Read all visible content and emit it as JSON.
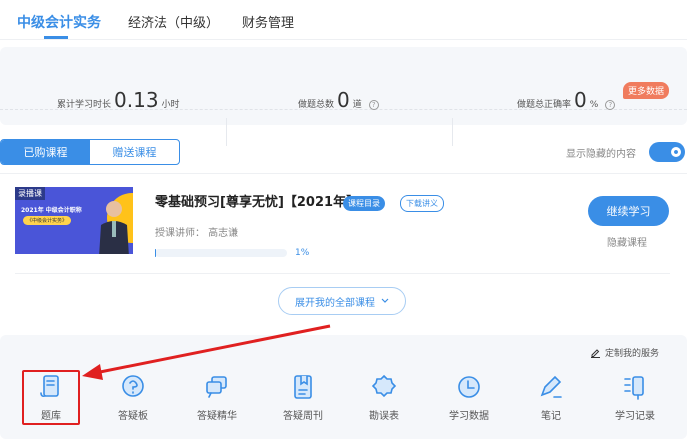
{
  "subject_tabs": [
    {
      "label": "中级会计实务",
      "active": true
    },
    {
      "label": "经济法（中级）"
    },
    {
      "label": "财务管理"
    }
  ],
  "stats": {
    "study_time_label": "累计学习时长",
    "study_time_value": "0.13",
    "study_time_unit": "小时",
    "questions_label": "做题总数",
    "questions_value": "0",
    "questions_unit": "道",
    "accuracy_label": "做题总正确率",
    "accuracy_value": "0",
    "accuracy_unit": "%",
    "help_icon": "?",
    "more_data": "更多数据"
  },
  "course_tabs": [
    {
      "label": "已购课程",
      "active": true
    },
    {
      "label": "赠送课程"
    }
  ],
  "show_hidden_label": "显示隐藏的内容",
  "show_hidden_on": true,
  "course": {
    "thumb_tag": "录播课",
    "thumb_title": "2021年 中级会计职称",
    "thumb_subtitle": "《中级会计实务》",
    "title": "零基础预习[尊享无忧]【2021年】",
    "catalog_label": "课程目录",
    "handout_label": "下载讲义",
    "teacher": "授课讲师： 高志谦",
    "progress_percent": 1,
    "progress_label": "1%",
    "continue_label": "继续学习",
    "hide_label": "隐藏课程"
  },
  "expand_label": "展开我的全部课程",
  "services": {
    "customize_label": "定制我的服务",
    "items": [
      {
        "label": "题库"
      },
      {
        "label": "答疑板"
      },
      {
        "label": "答疑精华"
      },
      {
        "label": "答疑周刊"
      },
      {
        "label": "勘误表"
      },
      {
        "label": "学习数据"
      },
      {
        "label": "笔记"
      },
      {
        "label": "学习记录"
      }
    ]
  },
  "colors": {
    "accent": "#3a8ee6",
    "annotation": "#e02020",
    "badge": "#f07c5e"
  }
}
